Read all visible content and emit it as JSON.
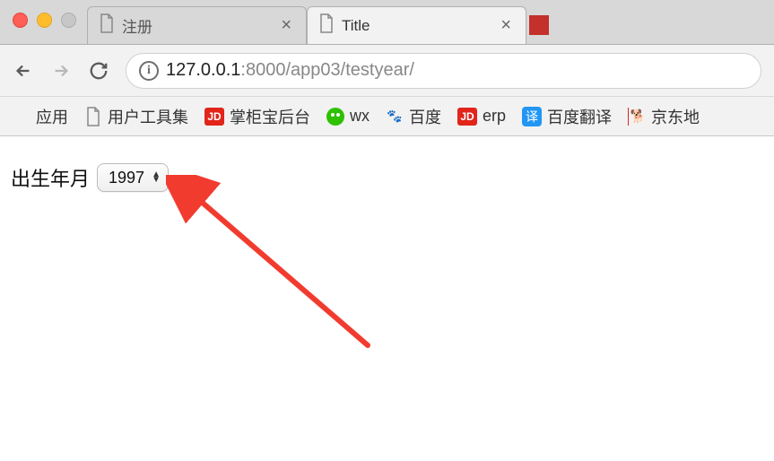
{
  "window": {
    "tabs": [
      {
        "title": "注册",
        "active": false
      },
      {
        "title": "Title",
        "active": true
      }
    ]
  },
  "nav": {
    "url_info_label": "i",
    "url_host": "127.0.0.1",
    "url_port": ":8000",
    "url_path": "/app03/testyear/"
  },
  "bookmarks": [
    {
      "id": "apps",
      "label": "应用"
    },
    {
      "id": "user-tools",
      "label": "用户工具集"
    },
    {
      "id": "zgb",
      "label": "掌柜宝后台"
    },
    {
      "id": "wx",
      "label": "wx"
    },
    {
      "id": "baidu",
      "label": "百度"
    },
    {
      "id": "erp",
      "label": "erp"
    },
    {
      "id": "fanyi",
      "label": "百度翻译"
    },
    {
      "id": "jd-map",
      "label": "京东地"
    }
  ],
  "page": {
    "label": "出生年月",
    "year_value": "1997"
  }
}
